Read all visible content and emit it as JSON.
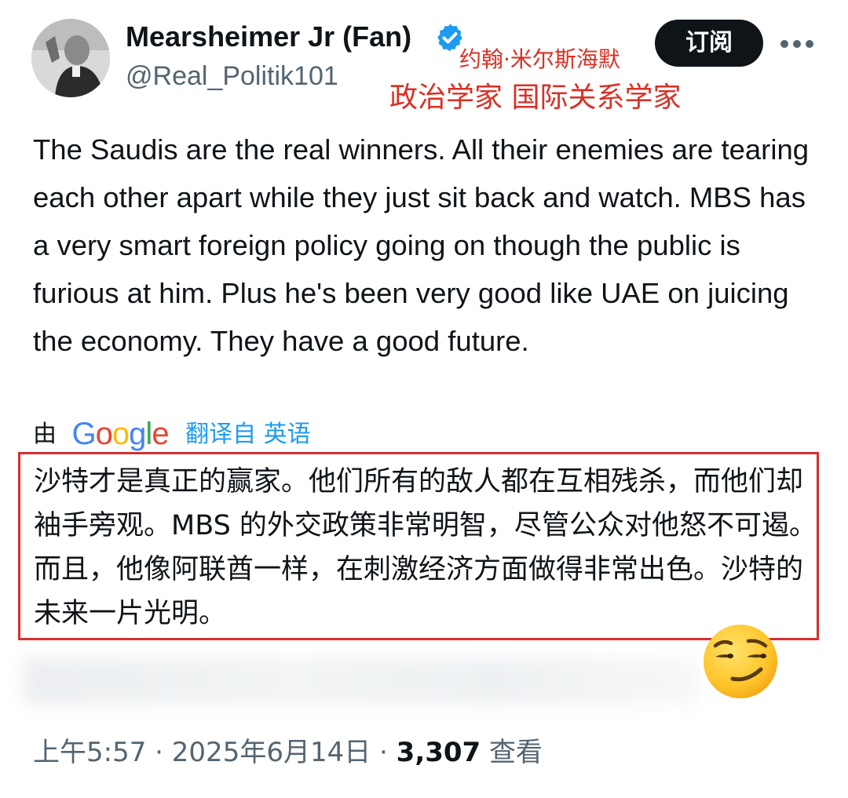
{
  "author": {
    "display_name": "Mearsheimer Jr (Fan)",
    "handle": "@Real_Politik101",
    "verified": true,
    "badge_color": "#1d9bf0"
  },
  "header_actions": {
    "subscribe_label": "订阅",
    "more_icon": "more-horizontal-icon"
  },
  "annotation": {
    "name": "约翰·米尔斯海默",
    "title": "政治学家 国际关系学家",
    "color": "#d93025"
  },
  "tweet": {
    "text": "The Saudis are the real winners. All their enemies are tearing each other apart while they just sit back and watch. MBS has a very smart foreign policy going on though the public is furious at him. Plus he's been very good like UAE on juicing the economy. They have a good future."
  },
  "translation": {
    "prefix": "由",
    "provider": "Google",
    "link_label": "翻译自 英语",
    "text": "沙特才是真正的赢家。他们所有的敌人都在互相残杀，而他们却袖手旁观。MBS 的外交政策非常明智，尽管公众对他怒不可遏。而且，他像阿联酋一样，在刺激经济方面做得非常出色。沙特的未来一片光明。",
    "highlight_color": "#d62e2e"
  },
  "emoji": "smirk-emoji",
  "meta": {
    "time": "上午5:57",
    "separator": "·",
    "date": "2025年6月14日",
    "views": "3,307",
    "views_label": "查看"
  }
}
